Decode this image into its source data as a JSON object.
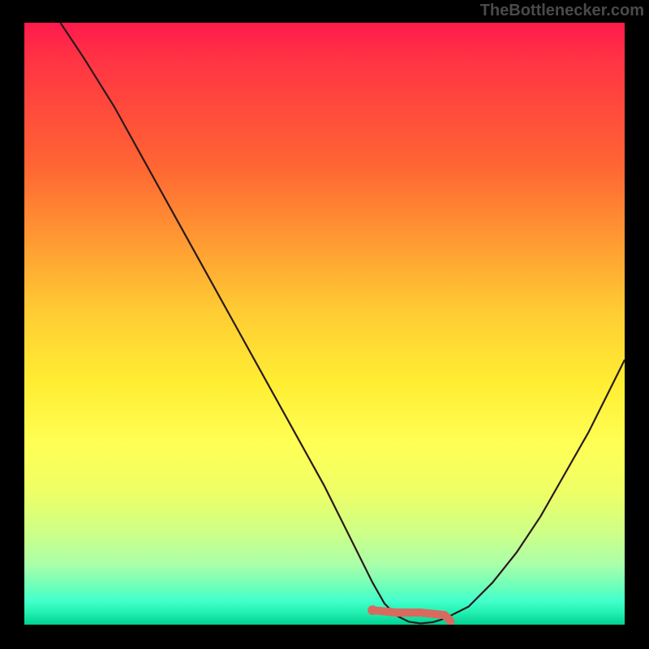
{
  "attribution": "TheBottlenecker.com",
  "colors": {
    "frame_background": "#000000",
    "attribution_text": "#4a4a4a",
    "curve": "#2a1a1a",
    "highlight": "#d86a5f",
    "gradient_top": "#ff1a4d",
    "gradient_bottom": "#00d090"
  },
  "chart_data": {
    "type": "line",
    "title": "",
    "xlabel": "",
    "ylabel": "",
    "xlim": [
      0,
      100
    ],
    "ylim": [
      0,
      100
    ],
    "grid": false,
    "legend": false,
    "series": [
      {
        "name": "bottleneck-curve",
        "x": [
          6,
          10,
          15,
          20,
          25,
          30,
          35,
          40,
          45,
          50,
          55,
          58,
          60,
          62,
          64,
          66,
          68,
          70,
          74,
          78,
          82,
          86,
          90,
          94,
          98,
          100
        ],
        "y": [
          100,
          94,
          86,
          77,
          68,
          59,
          50,
          41,
          32,
          23,
          13,
          7,
          3.5,
          1.5,
          0.5,
          0.2,
          0.4,
          1,
          3,
          7,
          12,
          18,
          25,
          32,
          40,
          44
        ]
      }
    ],
    "highlight_segment": {
      "x": [
        58,
        62,
        66,
        70,
        71
      ],
      "y": [
        2.4,
        2.0,
        2.0,
        1.6,
        0.6
      ]
    },
    "highlight_point": {
      "x": 58,
      "y": 2.4
    },
    "background_type": "vertical-gradient-heatmap"
  }
}
